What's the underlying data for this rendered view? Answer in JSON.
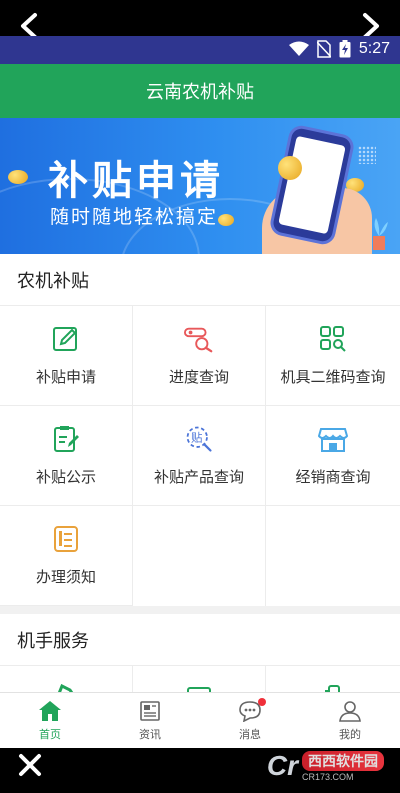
{
  "status": {
    "time": "5:27"
  },
  "app": {
    "title": "云南农机补贴"
  },
  "banner": {
    "title": "补贴申请",
    "subtitle": "随时随地轻松搞定"
  },
  "sections": [
    {
      "title": "农机补贴",
      "items": [
        {
          "label": "补贴申请",
          "icon": "edit-icon",
          "color": "#21a45a"
        },
        {
          "label": "进度查询",
          "icon": "progress-search-icon",
          "color": "#e8585a"
        },
        {
          "label": "机具二维码查询",
          "icon": "qrcode-search-icon",
          "color": "#21a45a"
        },
        {
          "label": "补贴公示",
          "icon": "notice-edit-icon",
          "color": "#21a45a"
        },
        {
          "label": "补贴产品查询",
          "icon": "subsidy-search-icon",
          "color": "#4b74d8"
        },
        {
          "label": "经销商查询",
          "icon": "store-icon",
          "color": "#4aa8e6"
        },
        {
          "label": "办理须知",
          "icon": "guide-icon",
          "color": "#e9a23b"
        }
      ]
    },
    {
      "title": "机手服务"
    }
  ],
  "bottom_nav": [
    {
      "label": "首页",
      "icon": "home-icon",
      "active": true
    },
    {
      "label": "资讯",
      "icon": "news-icon",
      "active": false
    },
    {
      "label": "消息",
      "icon": "message-icon",
      "active": false
    },
    {
      "label": "我的",
      "icon": "user-icon",
      "active": false
    }
  ],
  "watermark": {
    "brand": "西西软件园",
    "url": "CR173.COM"
  },
  "colors": {
    "primary": "#21a45a",
    "statusbar": "#2f3690",
    "banner": "#2f8ff0"
  }
}
